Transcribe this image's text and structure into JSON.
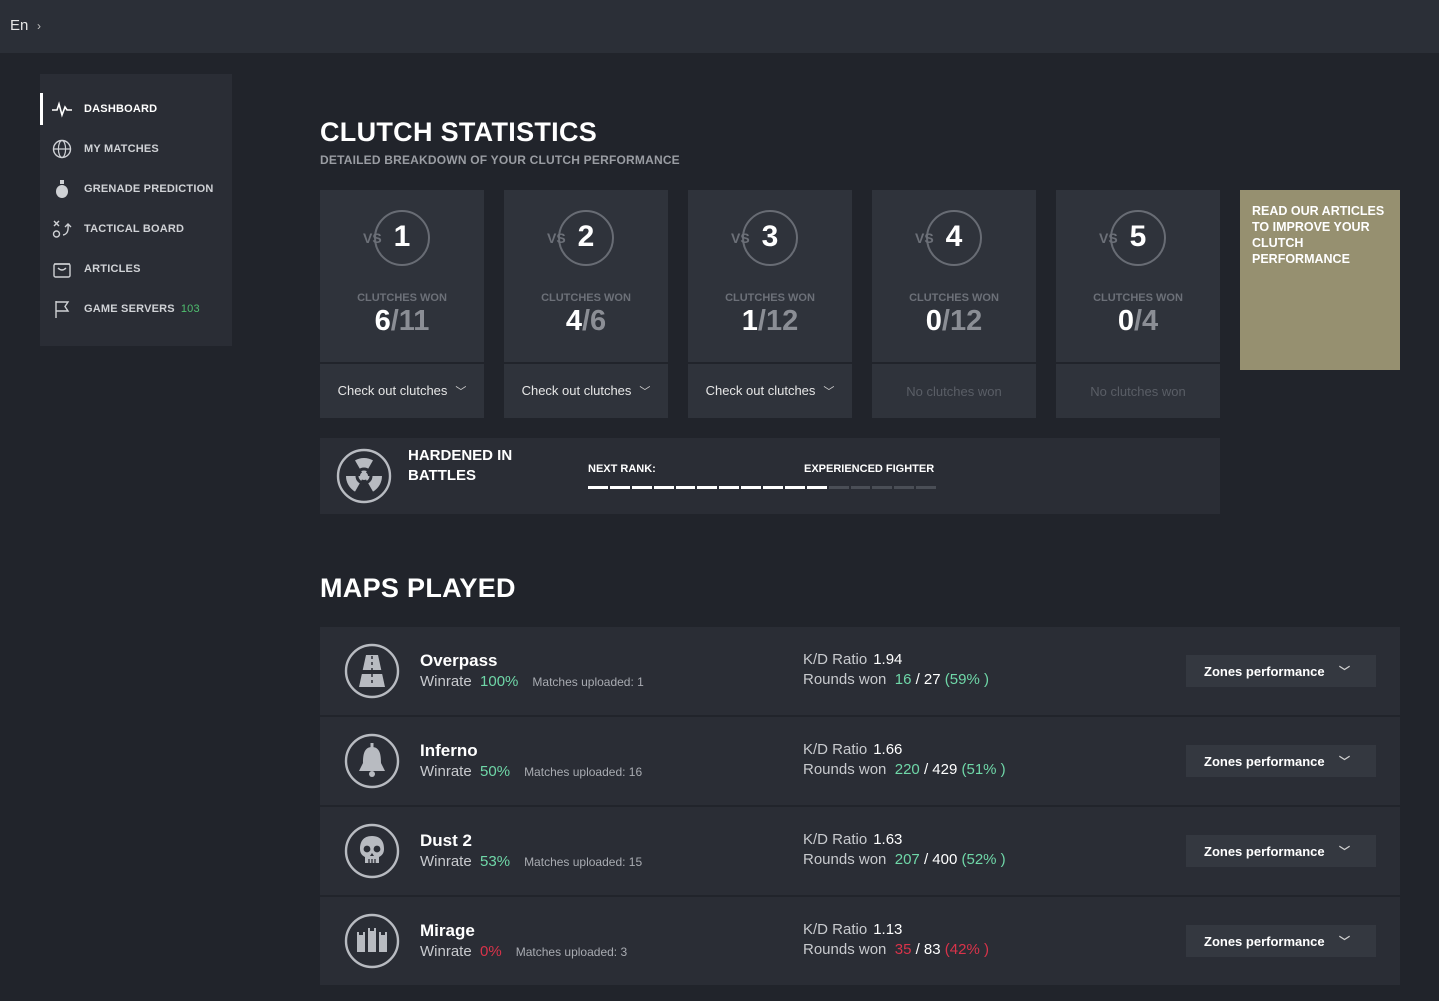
{
  "topbar": {
    "language": "En",
    "chevron": "›"
  },
  "sidebar": {
    "items": [
      {
        "label": "DASHBOARD",
        "icon": "pulse-icon",
        "active": true
      },
      {
        "label": "MY MATCHES",
        "icon": "globe-icon"
      },
      {
        "label": "GRENADE PREDICTION",
        "icon": "grenade-icon"
      },
      {
        "label": "TACTICAL BOARD",
        "icon": "tactics-icon"
      },
      {
        "label": "ARTICLES",
        "icon": "bag-icon"
      },
      {
        "label": "GAME SERVERS",
        "icon": "flag-icon",
        "badge": "103"
      }
    ]
  },
  "clutch": {
    "title": "CLUTCH STATISTICS",
    "subtitle": "DETAILED BREAKDOWN OF YOUR CLUTCH PERFORMANCE",
    "cards": [
      {
        "vs": "VS",
        "num": "1",
        "label": "CLUTCHES WON",
        "won": "6",
        "sep": "/",
        "total": "11",
        "action": "Check out clutches",
        "has_clutches": true
      },
      {
        "vs": "VS",
        "num": "2",
        "label": "CLUTCHES WON",
        "won": "4",
        "sep": "/",
        "total": "6",
        "action": "Check out clutches",
        "has_clutches": true
      },
      {
        "vs": "VS",
        "num": "3",
        "label": "CLUTCHES WON",
        "won": "1",
        "sep": "/",
        "total": "12",
        "action": "Check out clutches",
        "has_clutches": true
      },
      {
        "vs": "VS",
        "num": "4",
        "label": "CLUTCHES WON",
        "won": "0",
        "sep": "/",
        "total": "12",
        "action": "No clutches won",
        "has_clutches": false
      },
      {
        "vs": "VS",
        "num": "5",
        "label": "CLUTCHES WON",
        "won": "0",
        "sep": "/",
        "total": "4",
        "action": "No clutches won",
        "has_clutches": false
      }
    ],
    "promo": "READ OUR ARTICLES TO IMPROVE YOUR CLUTCH PERFORMANCE",
    "chevron": "﹀"
  },
  "rank": {
    "name": "HARDENED IN BATTLES",
    "next_label": "NEXT RANK:",
    "next_name": "EXPERIENCED FIGHTER",
    "progress_segments_filled": 11,
    "progress_segments_total": 16
  },
  "maps": {
    "title": "MAPS PLAYED",
    "winrate_label": "Winrate",
    "kd_label": "K/D Ratio",
    "rounds_label": "Rounds won",
    "zones_label": "Zones performance",
    "rows": [
      {
        "name": "Overpass",
        "icon": "overpass-icon",
        "winrate": "100%",
        "winrate_good": true,
        "matches": "Matches uploaded: 1",
        "kd": "1.94",
        "rounds_won": "16",
        "rounds_total": "/ 27",
        "rounds_pct": "(59% )"
      },
      {
        "name": "Inferno",
        "icon": "bell-icon",
        "winrate": "50%",
        "winrate_good": true,
        "matches": "Matches uploaded: 16",
        "kd": "1.66",
        "rounds_won": "220",
        "rounds_total": "/ 429",
        "rounds_pct": "(51% )"
      },
      {
        "name": "Dust 2",
        "icon": "skull-icon",
        "winrate": "53%",
        "winrate_good": true,
        "matches": "Matches uploaded: 15",
        "kd": "1.63",
        "rounds_won": "207",
        "rounds_total": "/ 400",
        "rounds_pct": "(52% )"
      },
      {
        "name": "Mirage",
        "icon": "towers-icon",
        "winrate": "0%",
        "winrate_good": false,
        "matches": "Matches uploaded: 3",
        "kd": "1.13",
        "rounds_won": "35",
        "rounds_total": "/ 83",
        "rounds_pct": "(42% )"
      }
    ]
  },
  "colors": {
    "accent_good": "#6fd7a8",
    "accent_bad": "#d9334a",
    "promo_bg": "#969070",
    "badge": "#4fbf6f"
  }
}
